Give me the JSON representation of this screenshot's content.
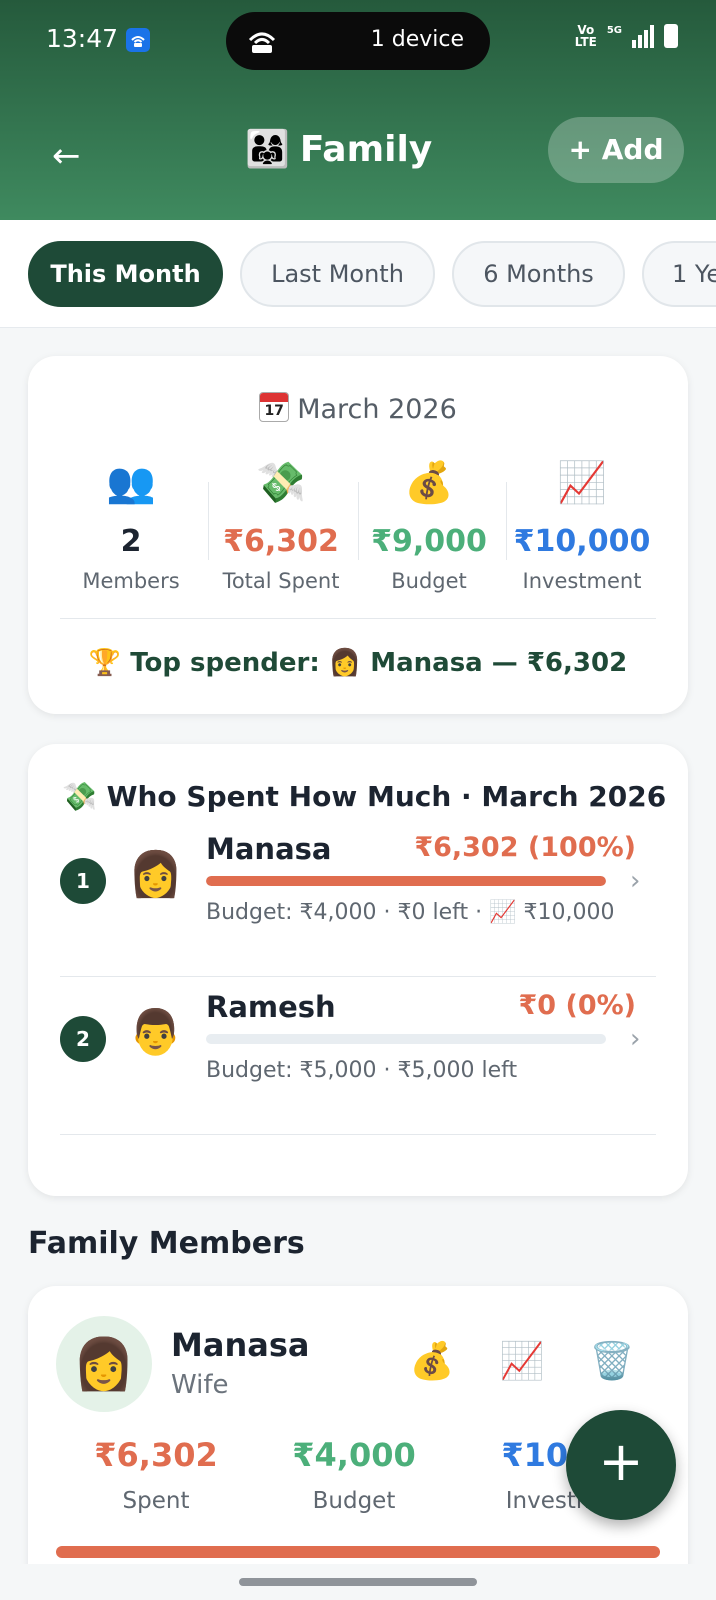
{
  "status_bar": {
    "time": "13:47",
    "hotspot_text": "1 device",
    "volte": "Vo\nLTE",
    "network": "5G"
  },
  "header": {
    "back_icon": "arrow-left",
    "title_emoji": "👨‍👩‍👧",
    "title": "Family",
    "add_label": "+ Add"
  },
  "tabs": [
    {
      "label": "This Month",
      "active": true
    },
    {
      "label": "Last Month",
      "active": false
    },
    {
      "label": "6 Months",
      "active": false
    },
    {
      "label": "1 Ye",
      "active": false
    }
  ],
  "summary": {
    "calendar_day": "17",
    "period": "March 2026",
    "stats": [
      {
        "icon": "👥",
        "value": "2",
        "label": "Members",
        "color": "#1c2430"
      },
      {
        "icon": "💸",
        "value": "₹6,302",
        "label": "Total Spent",
        "color": "#e06d4f"
      },
      {
        "icon": "💰",
        "value": "₹9,000",
        "label": "Budget",
        "color": "#4caf7a"
      },
      {
        "icon": "📈",
        "value": "₹10,000",
        "label": "Investment",
        "color": "#2f7ae0"
      }
    ],
    "top_spender_text": "🏆 Top spender: 👩 Manasa — ₹6,302"
  },
  "who_spent": {
    "title": "💸 Who Spent How Much · March 2026",
    "rows": [
      {
        "rank": "1",
        "avatar": "👩",
        "name": "Manasa",
        "amount": "₹6,302 (100%)",
        "share": 1.0,
        "sub": "Budget: ₹4,000 · ₹0 left  ·  📈 ₹10,000"
      },
      {
        "rank": "2",
        "avatar": "👨",
        "name": "Ramesh",
        "amount": "₹0 (0%)",
        "share": 0.0,
        "sub": "Budget: ₹5,000 · ₹5,000 left"
      }
    ]
  },
  "members_section": {
    "heading": "Family Members",
    "member": {
      "avatar": "👩",
      "name": "Manasa",
      "role": "Wife",
      "actions": [
        "💰",
        "📈",
        "🗑️"
      ],
      "stats": [
        {
          "value": "₹6,302",
          "label": "Spent",
          "color": "#e06d4f"
        },
        {
          "value": "₹4,000",
          "label": "Budget",
          "color": "#4caf7a"
        },
        {
          "value": "₹10,0",
          "label": "Investm",
          "color": "#2f7ae0"
        }
      ],
      "spent_share": 1.0
    }
  },
  "fab_label": "+"
}
